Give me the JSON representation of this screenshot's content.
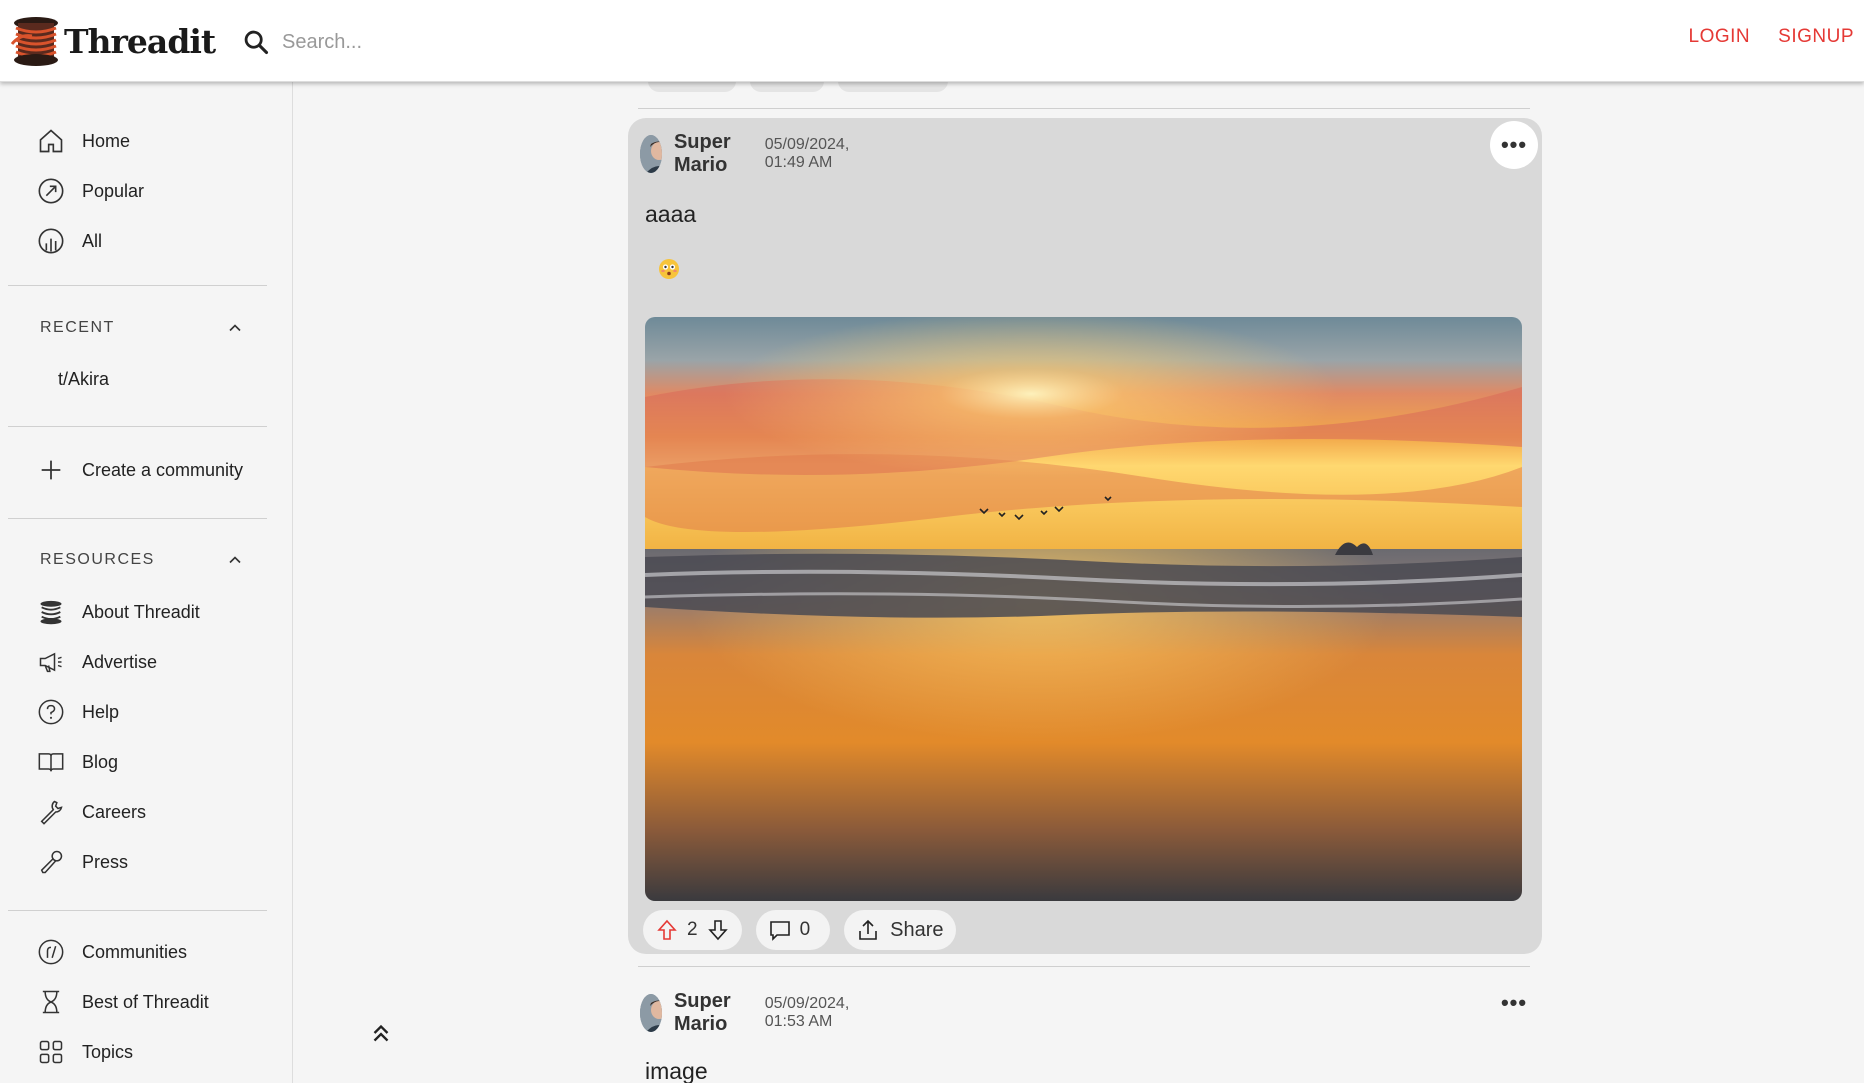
{
  "header": {
    "logo_text": "Threadit",
    "search_placeholder": "Search...",
    "login_label": "LOGIN",
    "signup_label": "SIGNUP",
    "accent_color": "#e53935"
  },
  "sidebar": {
    "main_items": [
      {
        "label": "Home",
        "icon": "home-icon"
      },
      {
        "label": "Popular",
        "icon": "trending-icon"
      },
      {
        "label": "All",
        "icon": "all-chart-icon"
      }
    ],
    "recent": {
      "heading": "RECENT",
      "items": [
        "t/Akira"
      ]
    },
    "create_community_label": "Create a community",
    "resources": {
      "heading": "RESOURCES",
      "items": [
        {
          "label": "About Threadit",
          "icon": "threadit-logo-icon"
        },
        {
          "label": "Advertise",
          "icon": "megaphone-icon"
        },
        {
          "label": "Help",
          "icon": "help-icon"
        },
        {
          "label": "Blog",
          "icon": "book-icon"
        },
        {
          "label": "Careers",
          "icon": "wrench-icon"
        },
        {
          "label": "Press",
          "icon": "microphone-icon"
        }
      ]
    },
    "bottom_items": [
      {
        "label": "Communities",
        "icon": "communities-icon"
      },
      {
        "label": "Best of Threadit",
        "icon": "hourglass-icon"
      },
      {
        "label": "Topics",
        "icon": "topics-grid-icon"
      }
    ]
  },
  "posts": [
    {
      "author": "Super Mario",
      "timestamp": "05/09/2024, 01:49 AM",
      "title": "aaaa",
      "upvotes": "2",
      "comments": "0",
      "share_label": "Share",
      "image": "sunset-beach-photo"
    },
    {
      "author": "Super Mario",
      "timestamp": "05/09/2024, 01:53 AM",
      "title": "image"
    }
  ]
}
